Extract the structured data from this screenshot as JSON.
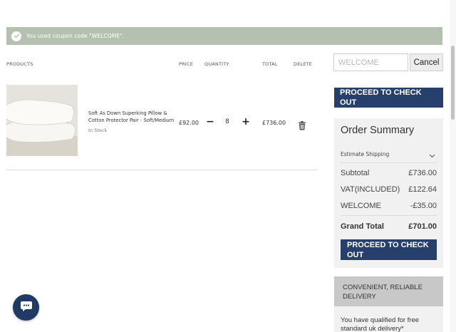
{
  "banner": {
    "message": "You used coupon code \"WELCOME\"."
  },
  "table_headers": {
    "products": "PRODUCTS",
    "price": "PRICE",
    "quantity": "QUANTITY",
    "total": "TOTAL",
    "delete": "DELETE"
  },
  "cart_item": {
    "name": "Soft As Down Superking Pillow & Cotton Protector Pair - Soft/Medium",
    "stock": "In Stock",
    "price": "£92.00",
    "quantity": "8",
    "total": "£736.00",
    "minus": "−",
    "plus": "+"
  },
  "coupon": {
    "value": "WELCOME",
    "cancel_label": "Cancel"
  },
  "checkout": {
    "label": "PROCEED TO CHECK OUT"
  },
  "summary": {
    "title": "Order Summary",
    "estimate_shipping": "Estimate Shipping",
    "rows": [
      {
        "label": "Subtotal",
        "value": "£736.00"
      },
      {
        "label": "VAT(INCLUDED)",
        "value": "£122.64"
      },
      {
        "label": "WELCOME",
        "value": "-£35.00"
      }
    ],
    "grand_total": {
      "label": "Grand Total",
      "value": "£701.00"
    }
  },
  "delivery": {
    "heading": "CONVENIENT, RELIABLE DELIVERY",
    "qualified": "You have qualified for free standard uk delivery*"
  },
  "colors": {
    "navy": "#27406b",
    "banner_green": "#b4c1b1",
    "chat": "#203a63"
  },
  "icons": {
    "banner": "check-circle-icon",
    "delete": "trash-icon",
    "shipping": "chevron-down-icon",
    "chat": "chat-bubble-icon"
  }
}
